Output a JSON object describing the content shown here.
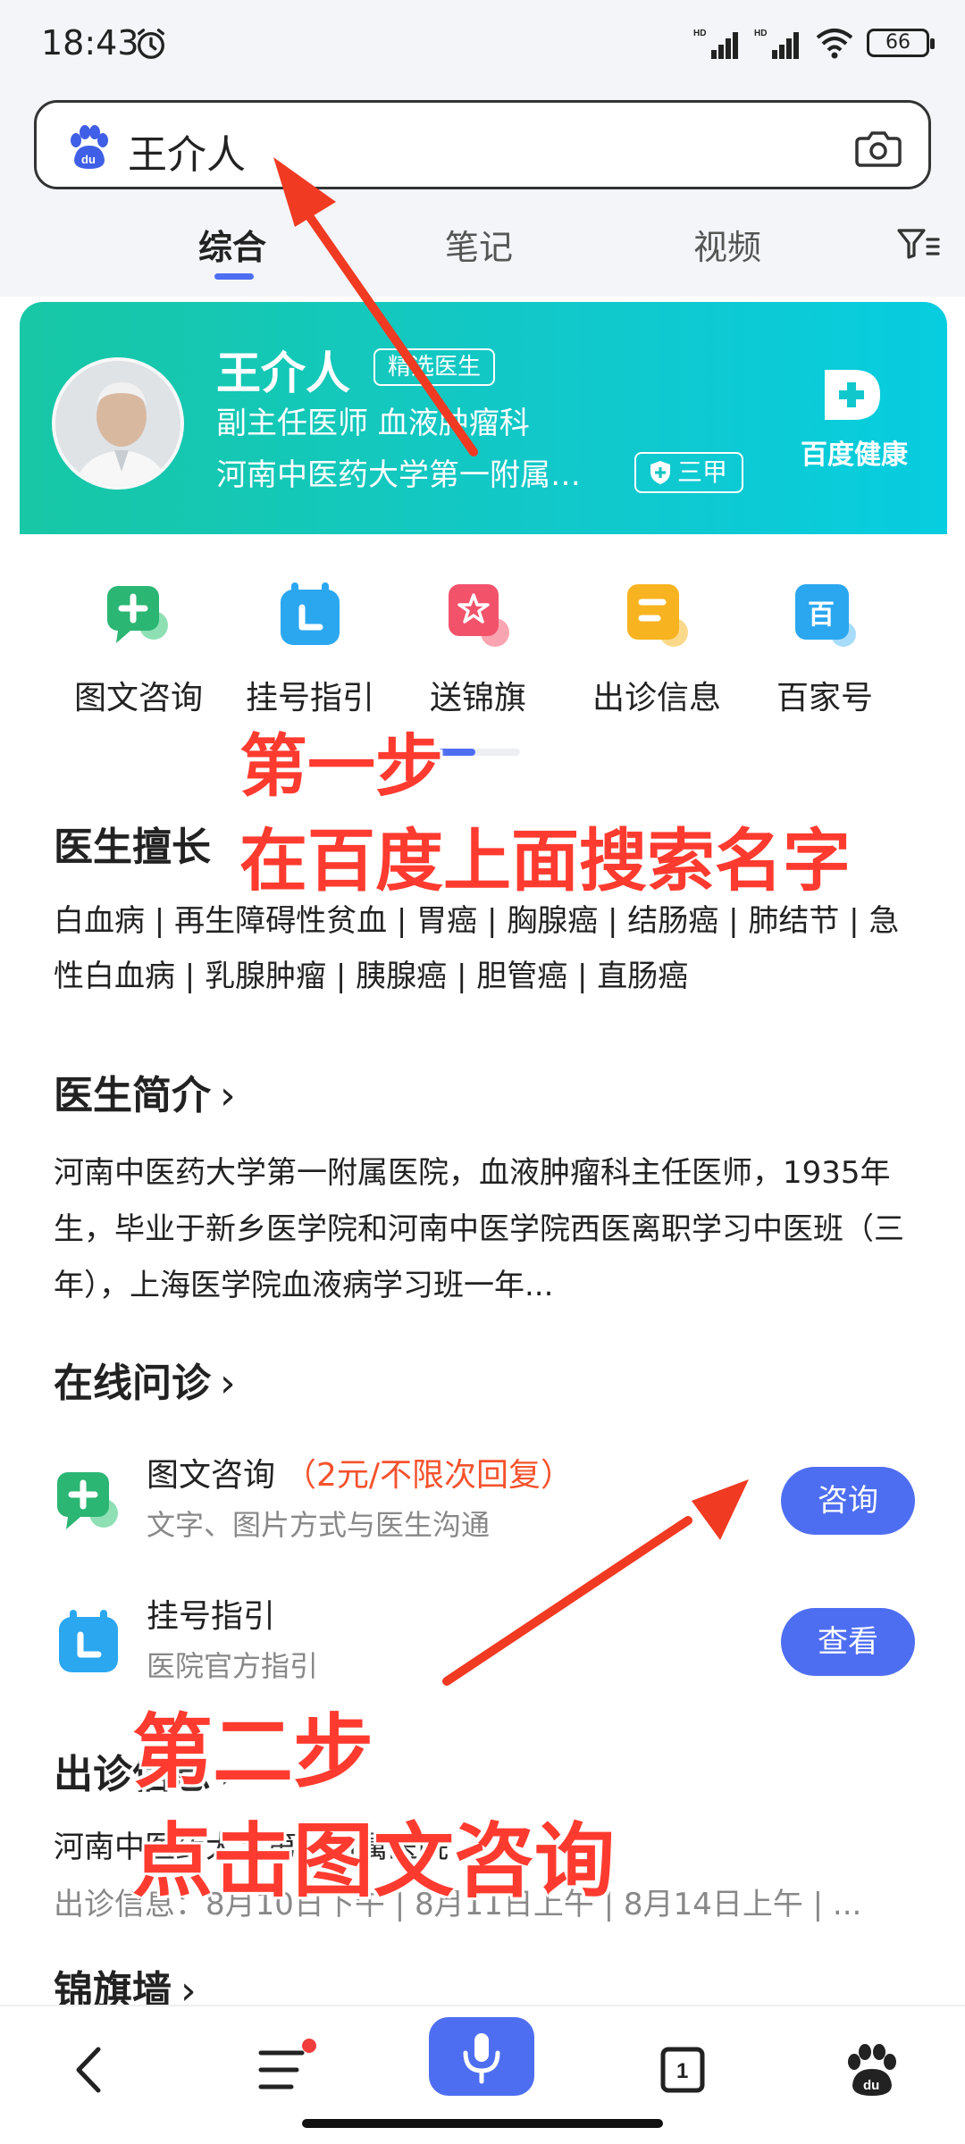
{
  "status_bar": {
    "time": "18:43",
    "battery": "66",
    "signal_label_1": "HD",
    "signal_label_2": "HD"
  },
  "search": {
    "query": "王介人"
  },
  "tabs": [
    {
      "label": "综合",
      "active": true
    },
    {
      "label": "笔记",
      "active": false
    },
    {
      "label": "视频",
      "active": false
    }
  ],
  "doctor": {
    "name": "王介人",
    "badge": "精选医生",
    "title": "副主任医师  血液肿瘤科",
    "hospital": "河南中医药大学第一附属医院",
    "grade": "三甲",
    "brand": "百度健康"
  },
  "actions": [
    {
      "label": "图文咨询",
      "icon": "chat-plus-icon",
      "color": "#2bb673"
    },
    {
      "label": "挂号指引",
      "icon": "calendar-icon",
      "color": "#2ba7f0"
    },
    {
      "label": "送锦旗",
      "icon": "star-flag-icon",
      "color": "#f2536b"
    },
    {
      "label": "出诊信息",
      "icon": "schedule-icon",
      "color": "#f7b320"
    },
    {
      "label": "百家号",
      "icon": "baijiahao-icon",
      "color": "#2ba7f0"
    }
  ],
  "sections": {
    "skills_title": "医生擅长",
    "skills_text": "白血病 | 再生障碍性贫血 | 胃癌 | 胸腺癌 | 结肠癌 | 肺结节 | 急性白血病 | 乳腺肿瘤 | 胰腺癌 | 胆管癌 | 直肠癌",
    "intro_title": "医生简介",
    "intro_text": "河南中医药大学第一附属医院，血液肿瘤科主任医师，1935年生，毕业于新乡医学院和河南中医学院西医离职学习中医班（三年），上海医学院血液病学习班一年...",
    "online_title": "在线问诊",
    "clinic_title": "出诊信息",
    "flag_title": "锦旗墙"
  },
  "consult": [
    {
      "title": "图文咨询",
      "price": "（2元/不限次回复）",
      "sub": "文字、图片方式与医生沟通",
      "button": "咨询"
    },
    {
      "title": "挂号指引",
      "price": "",
      "sub": "医院官方指引",
      "button": "查看"
    }
  ],
  "clinic": {
    "line1": "河南中医药大学第一附属医院",
    "line2": "出诊信息：8月10日下午 | 8月11日上午 | 8月14日上午 | ..."
  },
  "annotations": {
    "step1_title": "第一步",
    "step1_desc": "在百度上面搜索名字",
    "step2_title": "第二步",
    "step2_desc": "点击图文咨询"
  },
  "bottom_nav": {
    "tab_count": "1"
  }
}
